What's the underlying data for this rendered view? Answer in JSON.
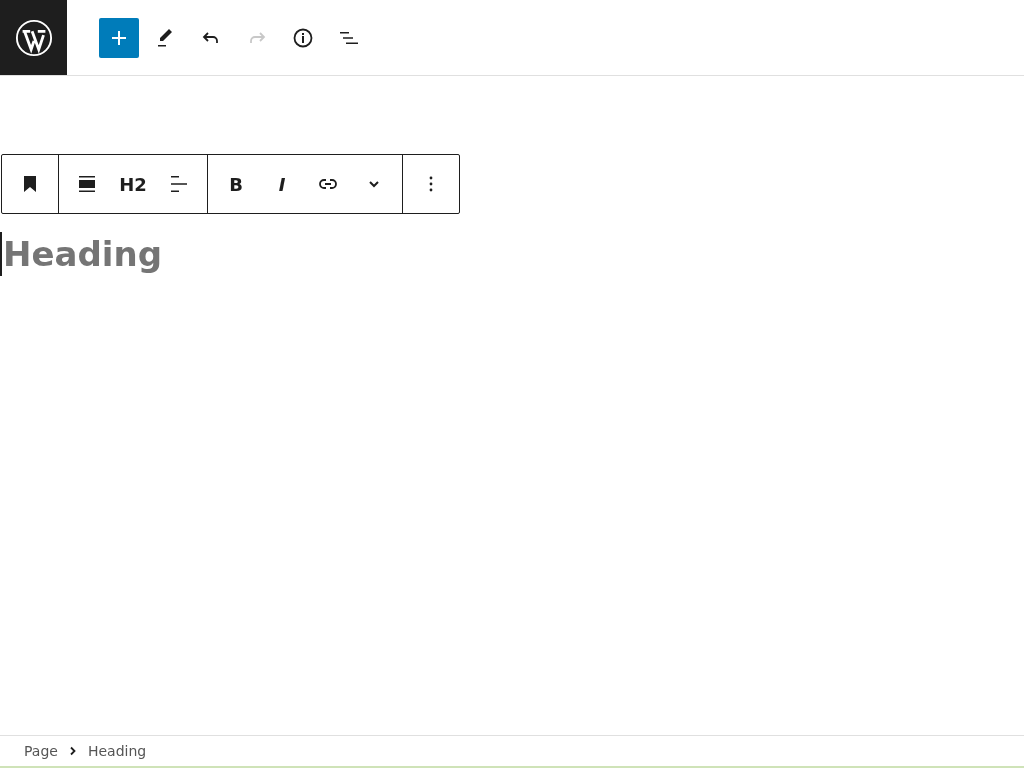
{
  "header": {
    "tools": [
      {
        "kind": "add",
        "primary": true,
        "disabled": false
      },
      {
        "kind": "edit",
        "primary": false,
        "disabled": false
      },
      {
        "kind": "undo",
        "primary": false,
        "disabled": false
      },
      {
        "kind": "redo",
        "primary": false,
        "disabled": true
      },
      {
        "kind": "info",
        "primary": false,
        "disabled": false
      },
      {
        "kind": "outline",
        "primary": false,
        "disabled": false
      }
    ]
  },
  "block_toolbar": {
    "groups": [
      [
        {
          "kind": "bookmark"
        }
      ],
      [
        {
          "kind": "align"
        },
        {
          "kind": "text",
          "label": "H2"
        },
        {
          "kind": "textalign"
        }
      ],
      [
        {
          "kind": "bold",
          "label": "B"
        },
        {
          "kind": "italic",
          "label": "I"
        },
        {
          "kind": "link"
        },
        {
          "kind": "chevron"
        }
      ],
      [
        {
          "kind": "more"
        }
      ]
    ]
  },
  "editor": {
    "heading_placeholder": "Heading"
  },
  "breadcrumbs": [
    "Page",
    "Heading"
  ]
}
